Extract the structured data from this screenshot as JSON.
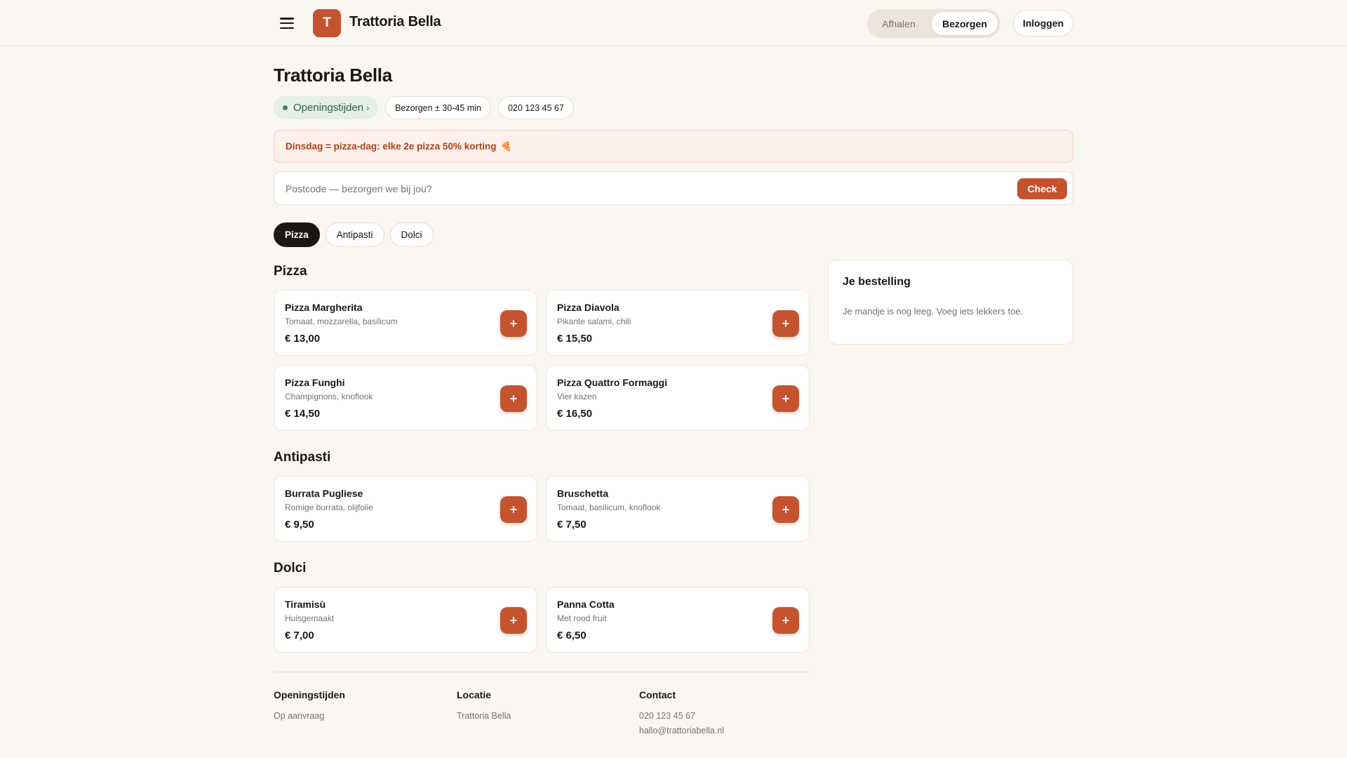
{
  "header": {
    "brand_initial": "T",
    "brand": "Trattoria Bella",
    "mode_pickup": "Afhalen",
    "mode_delivery": "Bezorgen",
    "login": "Inloggen"
  },
  "restaurant": {
    "title": "Trattoria Bella",
    "hours_pill": "Openingstijden",
    "delivery_pill": "Bezorgen ± 30-45 min",
    "phone_pill": "020 123 45 67"
  },
  "promo": {
    "text": "Dinsdag = pizza-dag: elke 2e pizza 50% korting",
    "icon": "🍕"
  },
  "postcode": {
    "placeholder": "Postcode — bezorgen we bij jou?",
    "value": "",
    "check_label": "Check"
  },
  "categories": [
    "Pizza",
    "Antipasti",
    "Dolci"
  ],
  "sections": [
    {
      "title": "Pizza",
      "items": [
        {
          "name": "Pizza Margherita",
          "desc": "Tomaat, mozzarella, basilicum",
          "price": "€ 13,00"
        },
        {
          "name": "Pizza Diavola",
          "desc": "Pikante salami, chili",
          "price": "€ 15,50"
        },
        {
          "name": "Pizza Funghi",
          "desc": "Champignons, knoflook",
          "price": "€ 14,50"
        },
        {
          "name": "Pizza Quattro Formaggi",
          "desc": "Vier kazen",
          "price": "€ 16,50"
        }
      ]
    },
    {
      "title": "Antipasti",
      "items": [
        {
          "name": "Burrata Pugliese",
          "desc": "Romige burrata, olijfolie",
          "price": "€ 9,50"
        },
        {
          "name": "Bruschetta",
          "desc": "Tomaat, basilicum, knoflook",
          "price": "€ 7,50"
        }
      ]
    },
    {
      "title": "Dolci",
      "items": [
        {
          "name": "Tiramisù",
          "desc": "Huisgemaakt",
          "price": "€ 7,00"
        },
        {
          "name": "Panna Cotta",
          "desc": "Met rood fruit",
          "price": "€ 6,50"
        }
      ]
    }
  ],
  "add_label": "+",
  "order": {
    "title": "Je bestelling",
    "empty": "Je mandje is nog leeg. Voeg iets lekkers toe."
  },
  "footer": {
    "hours_title": "Openingstijden",
    "hours_text": "Op aanvraag",
    "location_title": "Locatie",
    "location_text": "Trattoria Bella",
    "contact_title": "Contact",
    "contact_phone": "020 123 45 67",
    "contact_email": "hallo@trattoriabella.nl"
  },
  "colors": {
    "accent": "#c4532f",
    "background": "#faf7f3",
    "dark": "#1c1714",
    "open_green": "#3a8a58"
  }
}
